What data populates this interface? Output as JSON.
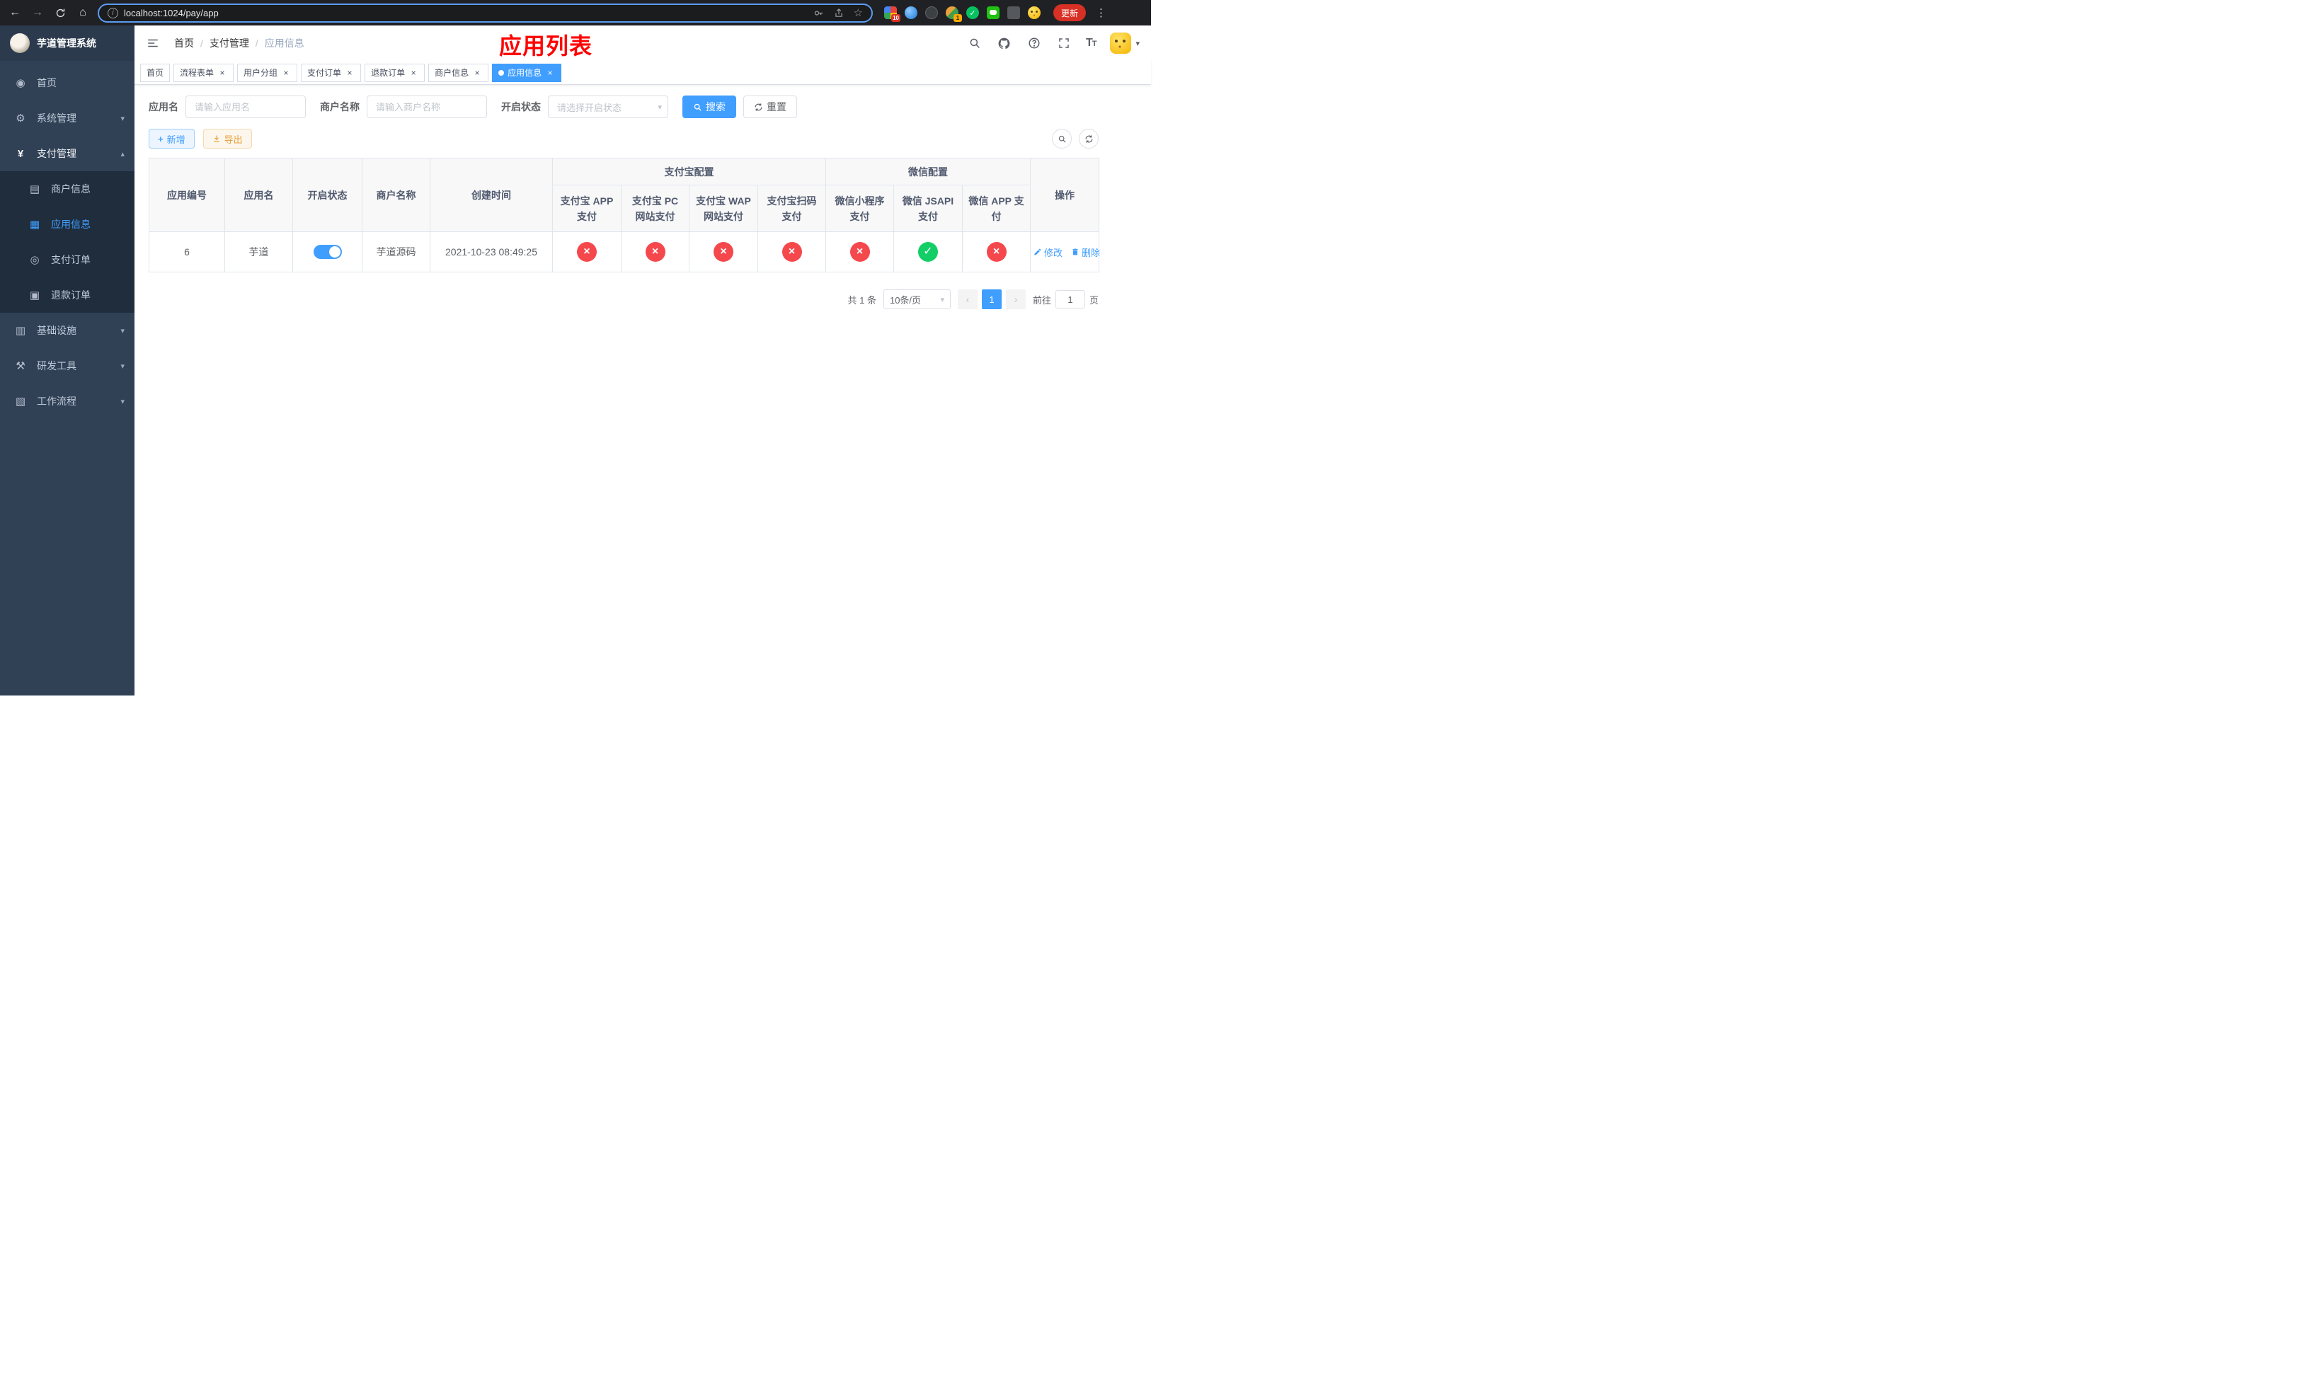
{
  "browser": {
    "url": "localhost:1024/pay/app",
    "update_label": "更新",
    "ext_badge_a": "10",
    "ext_badge_b": "1"
  },
  "colors": {
    "accent": "#409eff",
    "success": "#13ce66",
    "danger": "#f5484d",
    "warning": "#e6a23c",
    "sidebar_bg": "#304156",
    "overlay_title_red": "#ff0000"
  },
  "sidebar": {
    "title": "芋道管理系统",
    "items": [
      {
        "label": "首页"
      },
      {
        "label": "系统管理"
      },
      {
        "label": "支付管理"
      },
      {
        "label": "基础设施"
      },
      {
        "label": "研发工具"
      },
      {
        "label": "工作流程"
      }
    ],
    "payment_children": [
      {
        "label": "商户信息"
      },
      {
        "label": "应用信息"
      },
      {
        "label": "支付订单"
      },
      {
        "label": "退款订单"
      }
    ]
  },
  "header": {
    "breadcrumb": [
      "首页",
      "支付管理",
      "应用信息"
    ],
    "overlay_title": "应用列表"
  },
  "tabs": [
    {
      "label": "首页"
    },
    {
      "label": "流程表单"
    },
    {
      "label": "用户分组"
    },
    {
      "label": "支付订单"
    },
    {
      "label": "退款订单"
    },
    {
      "label": "商户信息"
    },
    {
      "label": "应用信息"
    }
  ],
  "filters": {
    "app_name_label": "应用名",
    "app_name_placeholder": "请输入应用名",
    "merchant_label": "商户名称",
    "merchant_placeholder": "请输入商户名称",
    "status_label": "开启状态",
    "status_placeholder": "请选择开启状态",
    "search_label": "搜索",
    "reset_label": "重置"
  },
  "toolbar": {
    "add_label": "新增",
    "export_label": "导出"
  },
  "table": {
    "headers": {
      "id": "应用编号",
      "name": "应用名",
      "status": "开启状态",
      "merchant": "商户名称",
      "created": "创建时间",
      "alipay_group": "支付宝配置",
      "wechat_group": "微信配置",
      "actions": "操作",
      "alipay_app": "支付宝 APP 支付",
      "alipay_pc": "支付宝 PC 网站支付",
      "alipay_wap": "支付宝 WAP 网站支付",
      "alipay_qr": "支付宝扫码支付",
      "wx_mini": "微信小程序支付",
      "wx_jsapi": "微信 JSAPI 支付",
      "wx_app": "微信 APP 支付"
    },
    "row": {
      "id": "6",
      "name": "芋道",
      "status_on": true,
      "merchant": "芋道源码",
      "created": "2021-10-23 08:49:25",
      "channels": [
        false,
        false,
        false,
        false,
        false,
        true,
        false
      ]
    },
    "actions": {
      "edit": "修改",
      "del": "删除"
    }
  },
  "pagination": {
    "total": "共 1 条",
    "page_size": "10条/页",
    "current": "1",
    "goto_label": "前往",
    "goto_value": "1",
    "goto_unit": "页"
  }
}
